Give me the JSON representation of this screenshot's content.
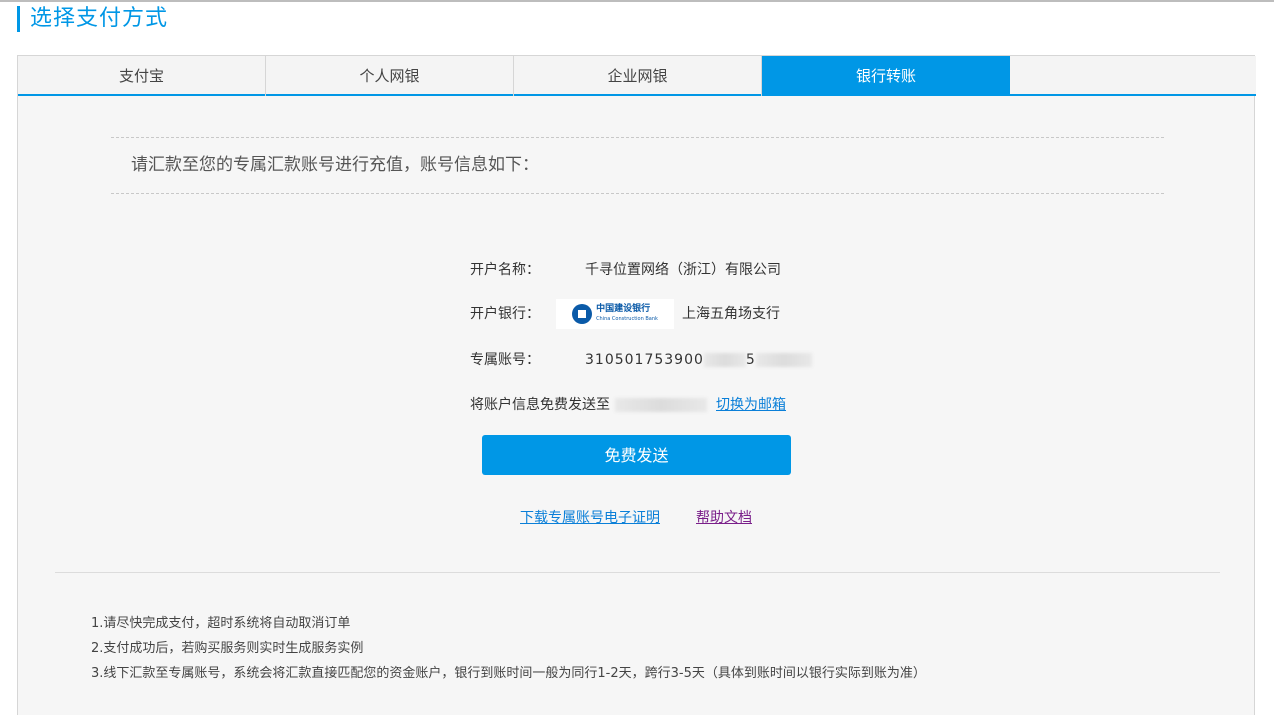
{
  "page": {
    "title": "选择支付方式"
  },
  "tabs": [
    {
      "label": "支付宝",
      "active": false
    },
    {
      "label": "个人网银",
      "active": false
    },
    {
      "label": "企业网银",
      "active": false
    },
    {
      "label": "银行转账",
      "active": true
    }
  ],
  "notice": "请汇款至您的专属汇款账号进行充值，账号信息如下：",
  "account": {
    "name_label": "开户名称：",
    "name_value": "千寻位置网络（浙江）有限公司",
    "bank_label": "开户银行：",
    "bank_logo_cn": "中国建设银行",
    "bank_logo_en": "China Construction Bank",
    "bank_branch": "上海五角场支行",
    "number_label": "专属账号：",
    "number_visible_prefix": "310501753900",
    "number_visible_mid": "5",
    "send_label": "将账户信息免费发送至",
    "switch_link": "切换为邮箱"
  },
  "send_button": "免费发送",
  "links": {
    "download": "下载专属账号电子证明",
    "help": "帮助文档"
  },
  "tips": [
    "1.请尽快完成支付，超时系统将自动取消订单",
    "2.支付成功后，若购买服务则实时生成服务实例",
    "3.线下汇款至专属账号，系统会将汇款直接匹配您的资金账户，银行到账时间一般为同行1-2天，跨行3-5天（具体到账时间以银行实际到账为准）"
  ],
  "colors": {
    "accent": "#0097e6",
    "link": "#0a7fd8",
    "visited_link": "#7a1f8a",
    "bank_blue": "#0a5aa8"
  },
  "icons": {
    "bank_logo": "ccb-logo-icon"
  }
}
